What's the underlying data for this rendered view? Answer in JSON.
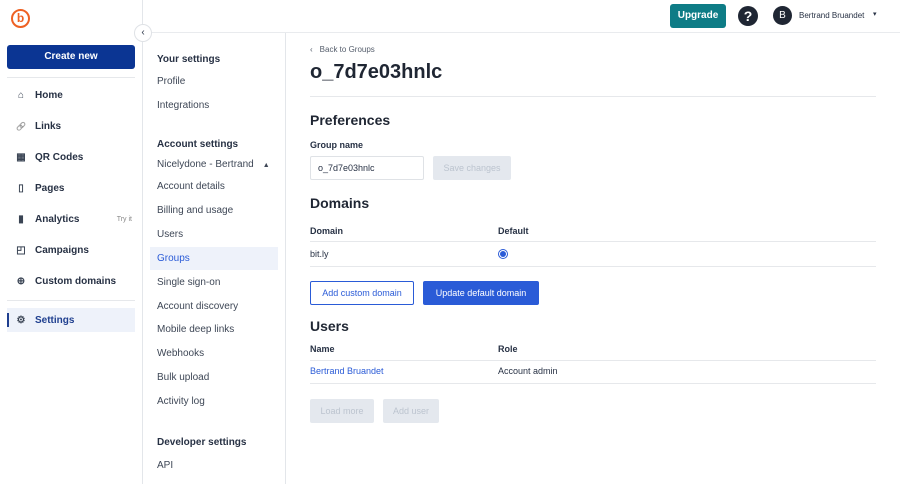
{
  "sidebar": {
    "logo": "b",
    "create_label": "Create new",
    "items": [
      {
        "label": "Home",
        "icon": "⌂"
      },
      {
        "label": "Links",
        "icon": "🔗"
      },
      {
        "label": "QR Codes",
        "icon": "▦"
      },
      {
        "label": "Pages",
        "icon": "▯"
      },
      {
        "label": "Analytics",
        "icon": "▮",
        "badge": "Try it"
      },
      {
        "label": "Campaigns",
        "icon": "◰"
      },
      {
        "label": "Custom domains",
        "icon": "⊕"
      }
    ],
    "settings": {
      "label": "Settings",
      "icon": "⚙"
    }
  },
  "header": {
    "upgrade": "Upgrade",
    "help": "?",
    "avatar": "B",
    "user": "Bertrand Bruandet",
    "caret": "▾"
  },
  "settings_nav": {
    "your_settings": "Your settings",
    "your_items": [
      "Profile",
      "Integrations"
    ],
    "account_settings": "Account settings",
    "account_name": "Nicelydone - Bertrand",
    "account_items": [
      "Account details",
      "Billing and usage",
      "Users",
      "Groups",
      "Single sign-on",
      "Account discovery",
      "Mobile deep links",
      "Webhooks",
      "Bulk upload",
      "Activity log"
    ],
    "developer_settings": "Developer settings",
    "developer_items": [
      "API"
    ]
  },
  "main": {
    "back": "Back to Groups",
    "title": "o_7d7e03hnlc",
    "preferences": "Preferences",
    "group_name_label": "Group name",
    "group_name_value": "o_7d7e03hnlc",
    "save": "Save changes",
    "domains": "Domains",
    "domain_cols": [
      "Domain",
      "Default"
    ],
    "domain_rows": [
      {
        "domain": "bit.ly",
        "default": true
      }
    ],
    "add_domain": "Add custom domain",
    "update_domain": "Update default domain",
    "users": "Users",
    "user_cols": [
      "Name",
      "Role"
    ],
    "user_rows": [
      {
        "name": "Bertrand Bruandet",
        "role": "Account admin"
      }
    ],
    "load_more": "Load more",
    "add_user": "Add user"
  }
}
